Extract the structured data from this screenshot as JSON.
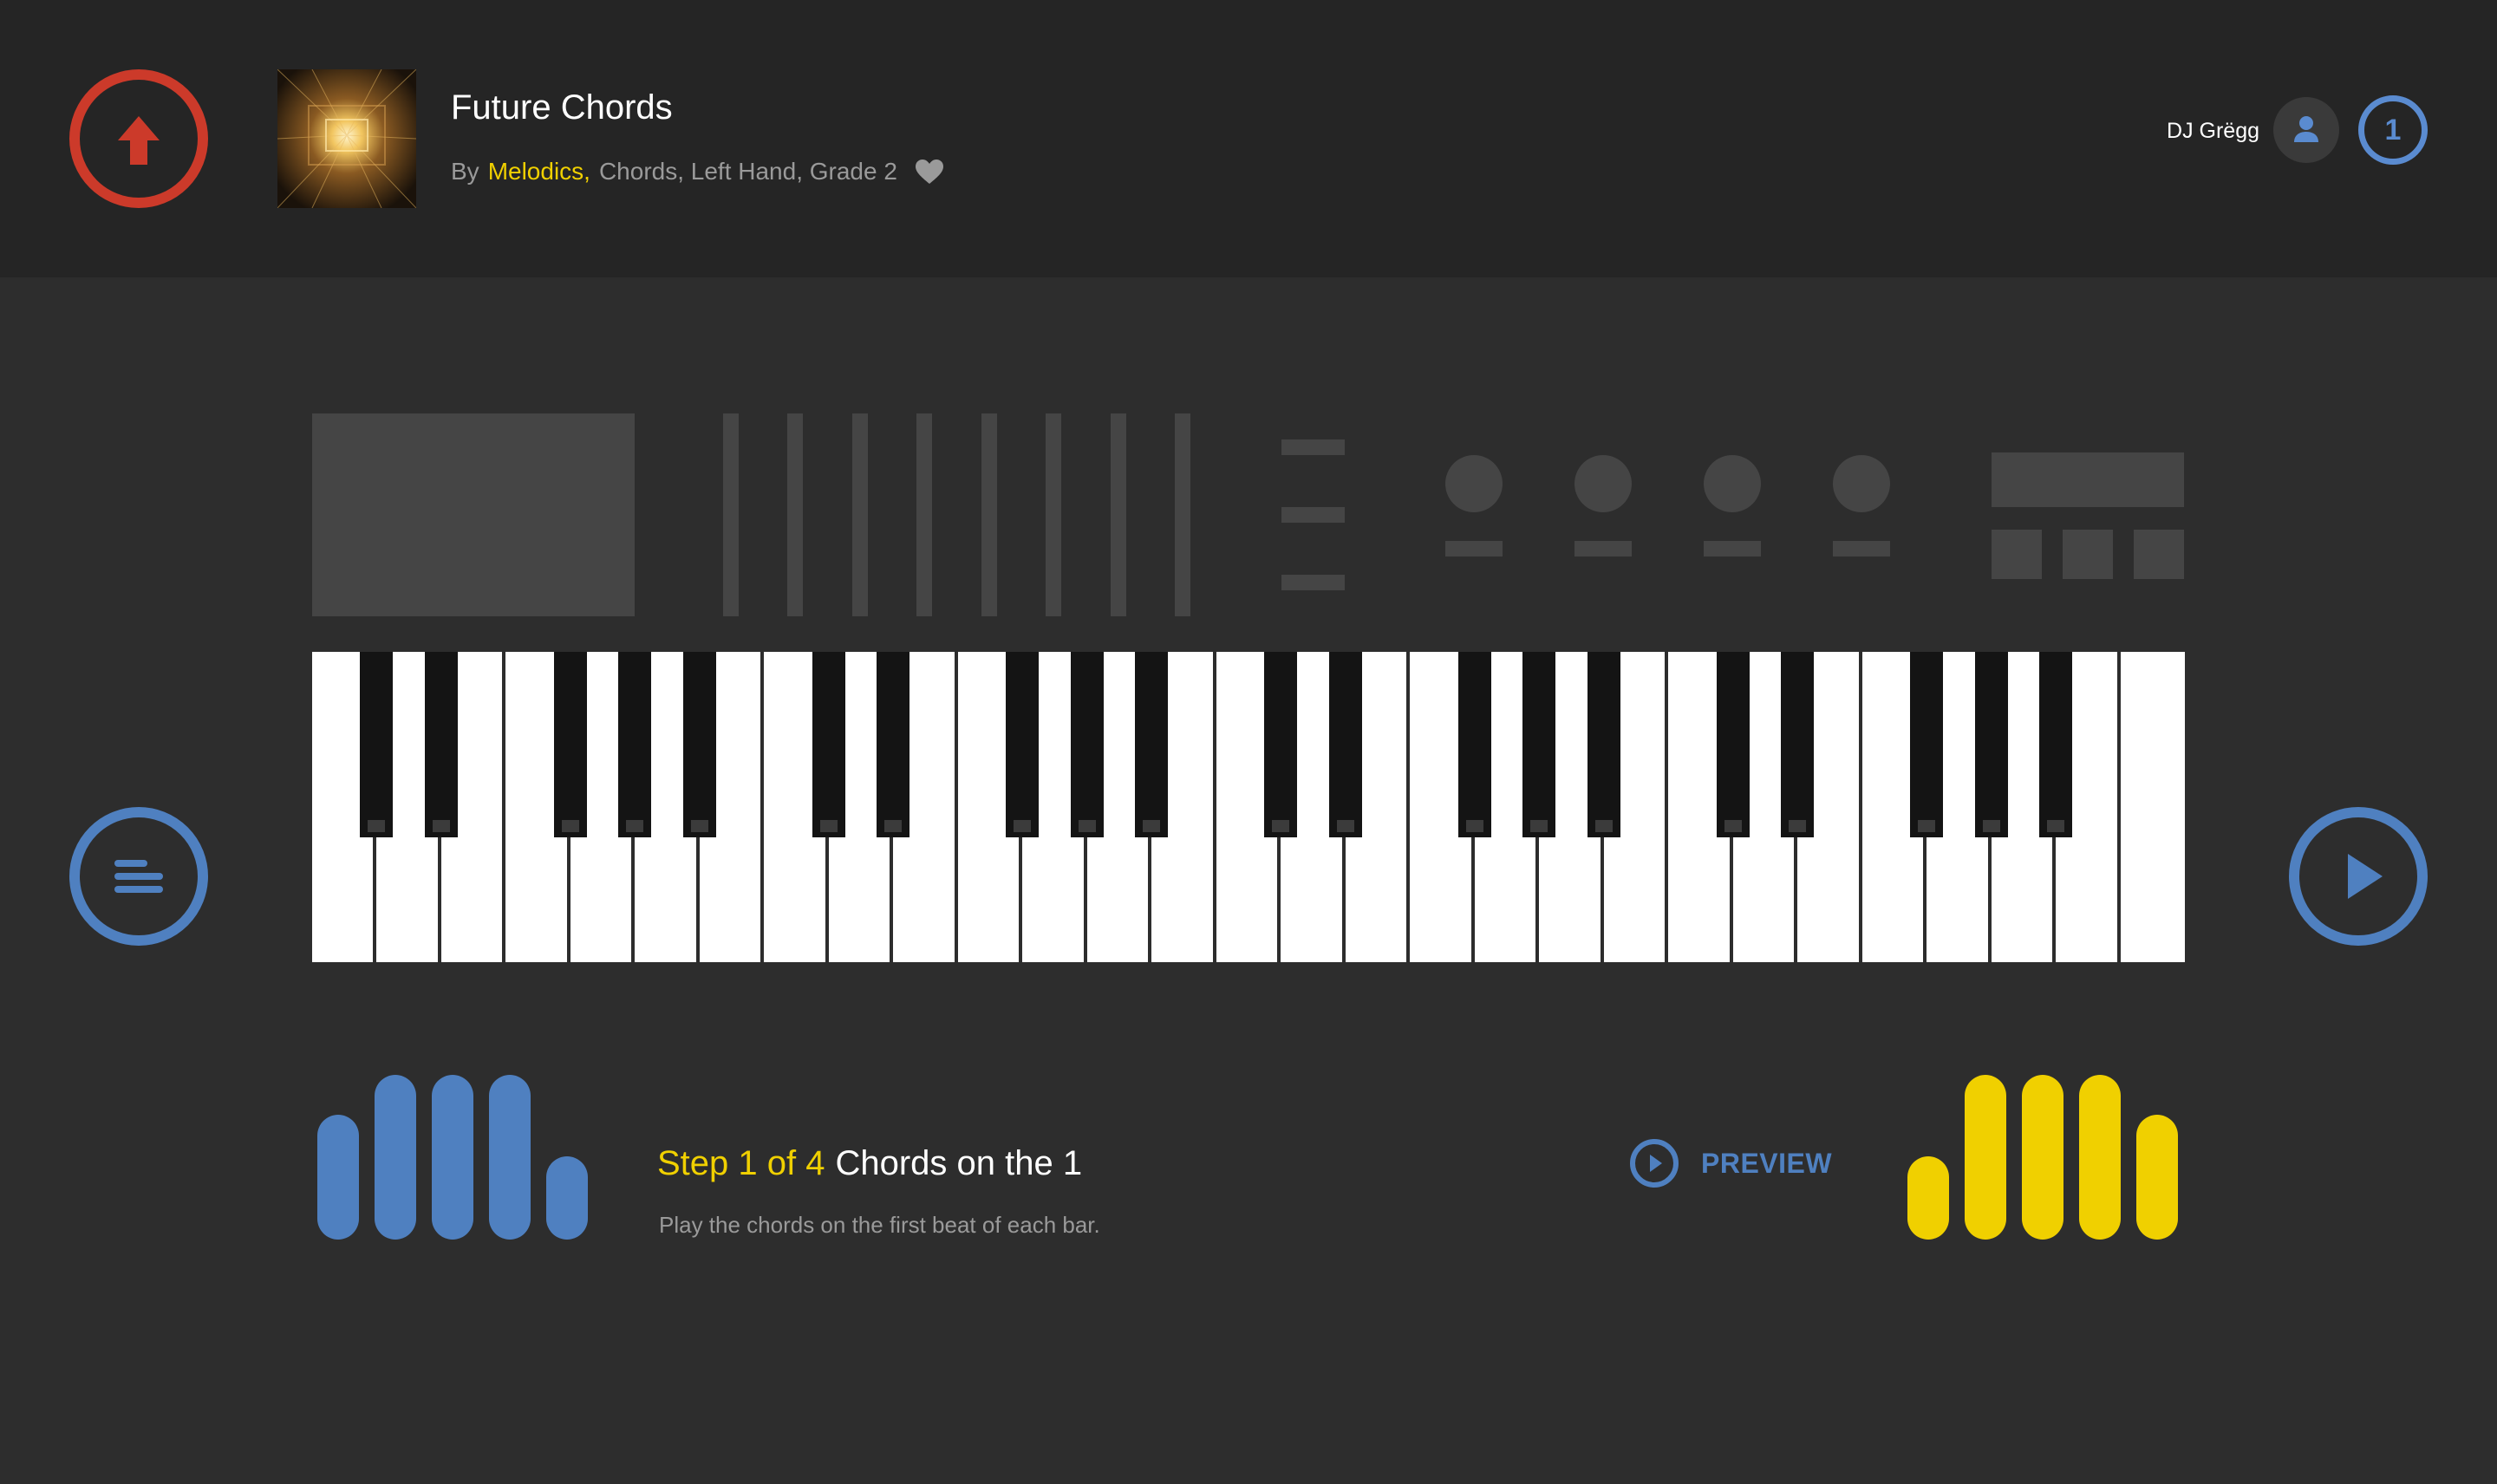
{
  "header": {
    "song_title": "Future Chords",
    "by_label": "By",
    "artist": "Melodics",
    "artist_comma": ",",
    "tags": "Chords, Left Hand, Grade 2",
    "user_name": "DJ Grëgg",
    "level": "1"
  },
  "icons": {
    "upload": "upload-arrow-icon",
    "favorite": "heart-icon",
    "profile": "user-icon",
    "menu": "menu-lines-icon",
    "play": "play-icon",
    "preview": "play-circle-icon"
  },
  "lesson": {
    "step_label": "Step 1 of 4",
    "step_name": "Chords on the 1",
    "description": "Play the chords on the first beat of each bar.",
    "preview_label": "PREVIEW"
  },
  "keyboard": {
    "white_keys": 29,
    "octaves": 4
  },
  "colors": {
    "background": "#2d2d2d",
    "header": "#252525",
    "upload_accent": "#cc3a2a",
    "blue_accent": "#4f80c0",
    "yellow_accent": "#f0d000",
    "synth_panel": "#454545"
  }
}
